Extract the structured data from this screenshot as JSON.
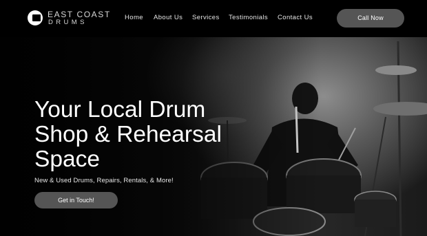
{
  "brand": {
    "line1": "EAST COAST",
    "line2": "DRUMS"
  },
  "nav": {
    "items": [
      {
        "label": "Home"
      },
      {
        "label": "About Us"
      },
      {
        "label": "Services"
      },
      {
        "label": "Testimonials"
      },
      {
        "label": "Contact Us"
      }
    ]
  },
  "header": {
    "call_label": "Call Now"
  },
  "hero": {
    "headline_1": "Your Local Drum",
    "headline_2": "Shop & Rehearsal",
    "headline_3": "Space",
    "subtitle": "New & Used Drums, Repairs, Rentals, & More!",
    "cta_label": "Get in Touch!"
  },
  "colors": {
    "background": "#000000",
    "button": "#555555",
    "text": "#ffffff"
  }
}
